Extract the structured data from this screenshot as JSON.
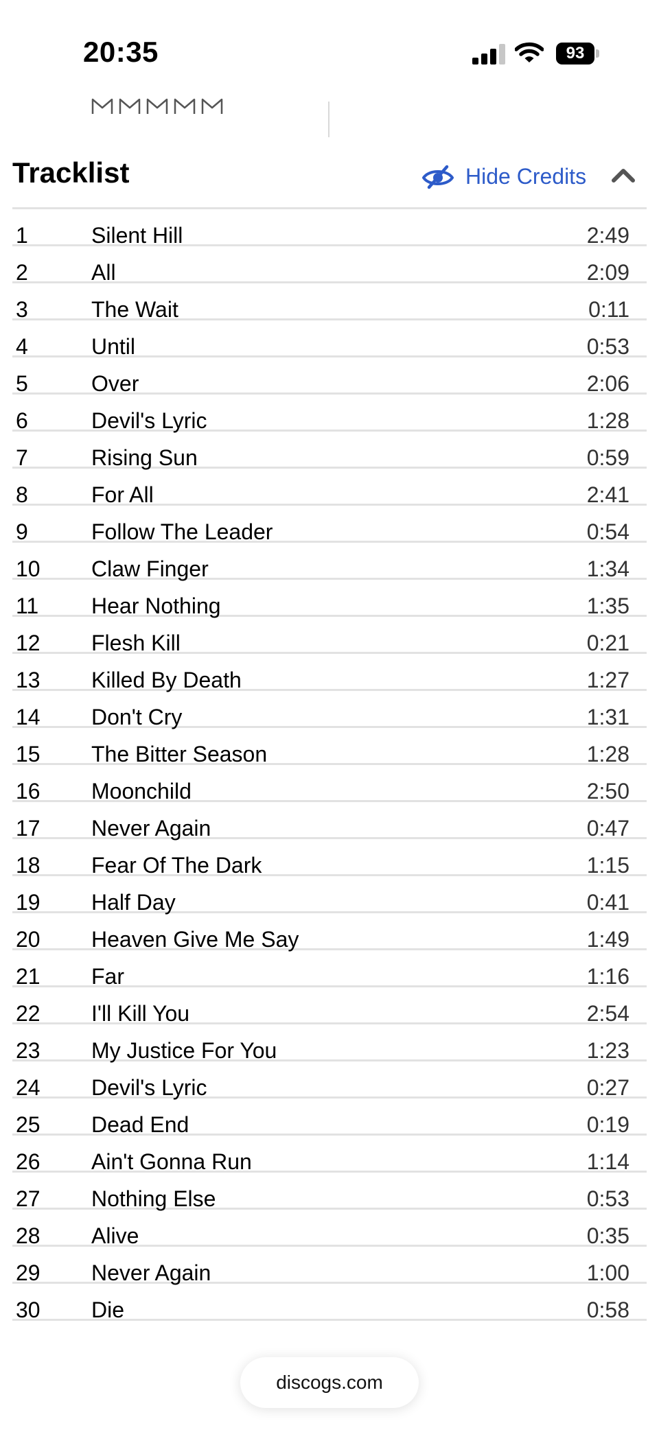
{
  "status_bar": {
    "time": "20:35",
    "battery_level": "93",
    "signal_bars_filled": 3,
    "signal_bars_total": 4
  },
  "rating": {
    "stars_total": 5,
    "stars_filled": 0
  },
  "tracklist": {
    "title": "Tracklist",
    "hide_credits_label": "Hide Credits",
    "accent_color": "#2d5bc9",
    "tracks": [
      {
        "pos": "1",
        "title": "Silent Hill",
        "duration": "2:49"
      },
      {
        "pos": "2",
        "title": "All",
        "duration": "2:09"
      },
      {
        "pos": "3",
        "title": "The Wait",
        "duration": "0:11"
      },
      {
        "pos": "4",
        "title": "Until",
        "duration": "0:53"
      },
      {
        "pos": "5",
        "title": "Over",
        "duration": "2:06"
      },
      {
        "pos": "6",
        "title": "Devil's Lyric",
        "duration": "1:28"
      },
      {
        "pos": "7",
        "title": "Rising Sun",
        "duration": "0:59"
      },
      {
        "pos": "8",
        "title": "For All",
        "duration": "2:41"
      },
      {
        "pos": "9",
        "title": "Follow The Leader",
        "duration": "0:54"
      },
      {
        "pos": "10",
        "title": "Claw Finger",
        "duration": "1:34"
      },
      {
        "pos": "11",
        "title": "Hear Nothing",
        "duration": "1:35"
      },
      {
        "pos": "12",
        "title": "Flesh Kill",
        "duration": "0:21"
      },
      {
        "pos": "13",
        "title": "Killed By Death",
        "duration": "1:27"
      },
      {
        "pos": "14",
        "title": "Don't Cry",
        "duration": "1:31"
      },
      {
        "pos": "15",
        "title": "The Bitter Season",
        "duration": "1:28"
      },
      {
        "pos": "16",
        "title": "Moonchild",
        "duration": "2:50"
      },
      {
        "pos": "17",
        "title": "Never Again",
        "duration": "0:47"
      },
      {
        "pos": "18",
        "title": "Fear Of The Dark",
        "duration": "1:15"
      },
      {
        "pos": "19",
        "title": "Half Day",
        "duration": "0:41"
      },
      {
        "pos": "20",
        "title": "Heaven Give Me Say",
        "duration": "1:49"
      },
      {
        "pos": "21",
        "title": "Far",
        "duration": "1:16"
      },
      {
        "pos": "22",
        "title": "I'll Kill You",
        "duration": "2:54"
      },
      {
        "pos": "23",
        "title": "My Justice For You",
        "duration": "1:23"
      },
      {
        "pos": "24",
        "title": "Devil's Lyric",
        "duration": "0:27"
      },
      {
        "pos": "25",
        "title": "Dead End",
        "duration": "0:19"
      },
      {
        "pos": "26",
        "title": "Ain't Gonna Run",
        "duration": "1:14"
      },
      {
        "pos": "27",
        "title": "Nothing Else",
        "duration": "0:53"
      },
      {
        "pos": "28",
        "title": "Alive",
        "duration": "0:35"
      },
      {
        "pos": "29",
        "title": "Never Again",
        "duration": "1:00"
      },
      {
        "pos": "30",
        "title": "Die",
        "duration": "0:58"
      }
    ]
  },
  "browser": {
    "url": "discogs.com"
  },
  "icons": {
    "signal": "cellular-signal-icon",
    "wifi": "wifi-icon",
    "battery": "battery-icon",
    "star": "star-outline-icon",
    "hide_credits": "eye-slash-icon",
    "collapse": "chevron-up-icon"
  }
}
